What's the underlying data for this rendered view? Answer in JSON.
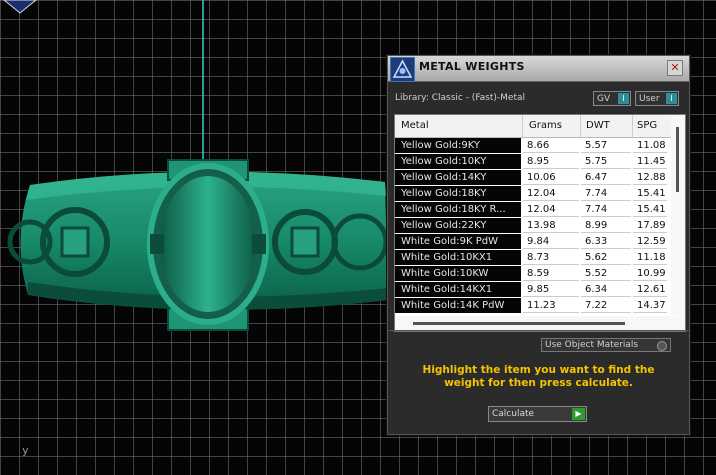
{
  "viewport": {
    "axis_label": "y",
    "model_color": "#1f8a6b",
    "grid_color": "#787878"
  },
  "panel": {
    "title": "METAL WEIGHTS",
    "close_symbol": "✕",
    "library_label": "Library: Classic - (Fast)-Metal",
    "toggles": {
      "gv": "GV",
      "user": "User",
      "toggle_marker": "I"
    },
    "table": {
      "columns": [
        "Metal",
        "Grams",
        "DWT",
        "SPG"
      ],
      "rows": [
        {
          "metal": "Yellow Gold:9KY",
          "grams": "8.66",
          "dwt": "5.57",
          "spg": "11.08"
        },
        {
          "metal": "Yellow Gold:10KY",
          "grams": "8.95",
          "dwt": "5.75",
          "spg": "11.45"
        },
        {
          "metal": "Yellow Gold:14KY",
          "grams": "10.06",
          "dwt": "6.47",
          "spg": "12.88"
        },
        {
          "metal": "Yellow Gold:18KY",
          "grams": "12.04",
          "dwt": "7.74",
          "spg": "15.41"
        },
        {
          "metal": "Yellow Gold:18KY R...",
          "grams": "12.04",
          "dwt": "7.74",
          "spg": "15.41"
        },
        {
          "metal": "Yellow Gold:22KY",
          "grams": "13.98",
          "dwt": "8.99",
          "spg": "17.89"
        },
        {
          "metal": "White Gold:9K PdW",
          "grams": "9.84",
          "dwt": "6.33",
          "spg": "12.59"
        },
        {
          "metal": "White Gold:10KX1",
          "grams": "8.73",
          "dwt": "5.62",
          "spg": "11.18"
        },
        {
          "metal": "White Gold:10KW",
          "grams": "8.59",
          "dwt": "5.52",
          "spg": "10.99"
        },
        {
          "metal": "White Gold:14KX1",
          "grams": "9.85",
          "dwt": "6.34",
          "spg": "12.61"
        },
        {
          "metal": "White Gold:14K PdW",
          "grams": "11.23",
          "dwt": "7.22",
          "spg": "14.37"
        }
      ]
    },
    "use_object_materials": "Use Object Materials",
    "hint": "Highlight the item you want to find the weight for then press calculate.",
    "calculate_label": "Calculate",
    "calculate_arrow": "▶"
  }
}
